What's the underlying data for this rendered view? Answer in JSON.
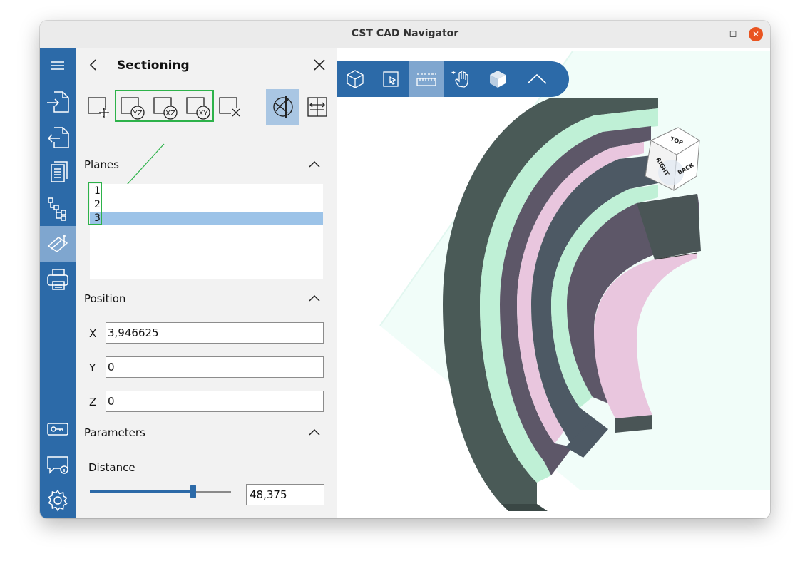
{
  "window": {
    "title": "CST CAD Navigator"
  },
  "rail": {
    "items": [
      "menu",
      "import",
      "export",
      "document",
      "tree",
      "sectioning",
      "print",
      "license",
      "feedback",
      "settings"
    ],
    "active": "sectioning"
  },
  "panel": {
    "title": "Sectioning",
    "tools": [
      "add-plane",
      "plane-yz",
      "plane-xz",
      "plane-xy",
      "delete-plane",
      "toggle-section",
      "flip-section"
    ],
    "tool_labels": {
      "yz": "YZ",
      "xz": "XZ",
      "xy": "XY"
    },
    "planes": {
      "header": "Planes",
      "items": [
        "1",
        "2",
        "3"
      ],
      "selected": "3"
    },
    "position": {
      "header": "Position",
      "x_label": "X",
      "x_value": "3,946625",
      "y_label": "Y",
      "y_value": "0",
      "z_label": "Z",
      "z_value": "0"
    },
    "parameters": {
      "header": "Parameters",
      "distance_label": "Distance",
      "distance_value": "48,375",
      "distance_fraction": 0.73
    }
  },
  "viewport": {
    "toolbar": [
      "view-cube",
      "select",
      "measure",
      "pan",
      "shaded-cube",
      "collapse"
    ],
    "active_tool": "measure",
    "navcube_labels": {
      "top": "TOP",
      "right": "RIGHT",
      "back": "BACK"
    }
  },
  "colors": {
    "accent": "#2c6aa8",
    "accent_active": "#7fa6cf",
    "highlight_green": "#2db24a",
    "selection": "#9cc3e8",
    "model_dark": "#4a5a57",
    "model_purple": "#5d5768",
    "model_mint": "#bff0d6",
    "model_pink": "#e9c6de"
  }
}
